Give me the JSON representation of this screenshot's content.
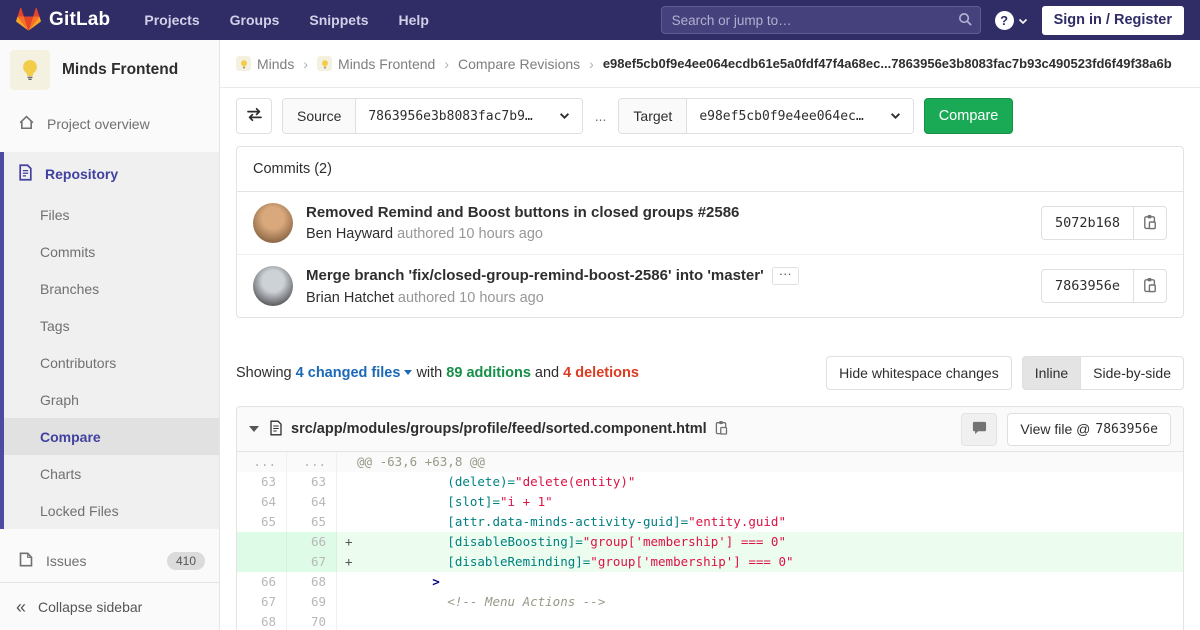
{
  "navbar": {
    "logo_text": "GitLab",
    "links": [
      "Projects",
      "Groups",
      "Snippets",
      "Help"
    ],
    "search_placeholder": "Search or jump to…",
    "help_glyph": "?",
    "signin_label": "Sign in / Register"
  },
  "breadcrumb": {
    "group": "Minds",
    "project": "Minds Frontend",
    "section": "Compare Revisions",
    "current": "e98ef5cb0f9e4ee064ecdb61e5a0fdf47f4a68ec...7863956e3b8083fac7b93c490523fd6f49f38a6b",
    "separator": "›"
  },
  "sidebar": {
    "project_name": "Minds Frontend",
    "overview_label": "Project overview",
    "repository_label": "Repository",
    "repo_items": [
      "Files",
      "Commits",
      "Branches",
      "Tags",
      "Contributors",
      "Graph",
      "Compare",
      "Charts",
      "Locked Files"
    ],
    "active_repo_item": "Compare",
    "issues_label": "Issues",
    "issues_count": "410",
    "collapse_label": "Collapse sidebar"
  },
  "compare_form": {
    "source_label": "Source",
    "source_value": "7863956e3b8083fac7b9…",
    "separator": "...",
    "target_label": "Target",
    "target_value": "e98ef5cb0f9e4ee064ec…",
    "compare_button": "Compare"
  },
  "commits_panel": {
    "header": "Commits (2)",
    "commits": [
      {
        "title": "Removed Remind and Boost buttons in closed groups #2586",
        "author": "Ben Hayward",
        "meta": "authored 10 hours ago",
        "sha": "5072b168",
        "expander": false,
        "avatar": {
          "inner": "#d9a87c",
          "outer": "#7d5b3a"
        }
      },
      {
        "title": "Merge branch 'fix/closed-group-remind-boost-2586' into 'master'",
        "author": "Brian Hatchet",
        "meta": "authored 10 hours ago",
        "sha": "7863956e",
        "expander": true,
        "avatar": {
          "inner": "#cdd2d6",
          "outer": "#45464a"
        }
      }
    ]
  },
  "diff_summary": {
    "showing": "Showing",
    "files_link": "4 changed files",
    "with": "with",
    "additions": "89 additions",
    "and": "and",
    "deletions": "4 deletions",
    "hide_whitespace_label": "Hide whitespace changes",
    "inline_label": "Inline",
    "side_by_side_label": "Side-by-side",
    "active_view": "Inline"
  },
  "diff_file": {
    "path": "src/app/modules/groups/profile/feed/sorted.component.html",
    "view_file_label": "View file @",
    "view_file_sha": "7863956e",
    "rows": [
      {
        "type": "hunk",
        "old": "...",
        "new": "...",
        "marker": "",
        "segments": [
          {
            "cls": "hunk",
            "text": "@@ -63,6 +63,8 @@"
          }
        ]
      },
      {
        "type": "context",
        "old": "63",
        "new": "63",
        "marker": "",
        "segments": [
          {
            "cls": "attr",
            "text": "            (delete)="
          },
          {
            "cls": "str",
            "text": "\"delete(entity)\""
          }
        ]
      },
      {
        "type": "context",
        "old": "64",
        "new": "64",
        "marker": "",
        "segments": [
          {
            "cls": "attr",
            "text": "            [slot]="
          },
          {
            "cls": "str",
            "text": "\"i + 1\""
          }
        ]
      },
      {
        "type": "context",
        "old": "65",
        "new": "65",
        "marker": "",
        "segments": [
          {
            "cls": "attr",
            "text": "            [attr.data-minds-activity-guid]="
          },
          {
            "cls": "str",
            "text": "\"entity.guid\""
          }
        ]
      },
      {
        "type": "add",
        "old": "",
        "new": "66",
        "marker": "+",
        "segments": [
          {
            "cls": "attr",
            "text": "            [disableBoosting]="
          },
          {
            "cls": "str",
            "text": "\"group['membership'] === 0\""
          }
        ]
      },
      {
        "type": "add",
        "old": "",
        "new": "67",
        "marker": "+",
        "segments": [
          {
            "cls": "attr",
            "text": "            [disableReminding]="
          },
          {
            "cls": "str",
            "text": "\"group['membership'] === 0\""
          }
        ]
      },
      {
        "type": "context",
        "old": "66",
        "new": "68",
        "marker": "",
        "segments": [
          {
            "cls": "tag",
            "text": "          >"
          }
        ]
      },
      {
        "type": "context",
        "old": "67",
        "new": "69",
        "marker": "",
        "segments": [
          {
            "cls": "cmt",
            "text": "            <!-- Menu Actions -->"
          }
        ]
      },
      {
        "type": "context",
        "old": "68",
        "new": "70",
        "marker": "",
        "segments": []
      }
    ]
  },
  "colors": {
    "navbar_bg": "#2f2c66",
    "sidebar_active_indigo": "#41419f",
    "accent_green_button": "#1aaa55",
    "link_blue": "#1b69b6",
    "additions_green": "#168f48",
    "deletions_red": "#db3b21",
    "added_line_bg": "#ecfdf0",
    "added_linenum_bg": "#ddfbe6",
    "syntax_attr": "#008080",
    "syntax_string": "#d14",
    "syntax_tag": "#000080"
  }
}
